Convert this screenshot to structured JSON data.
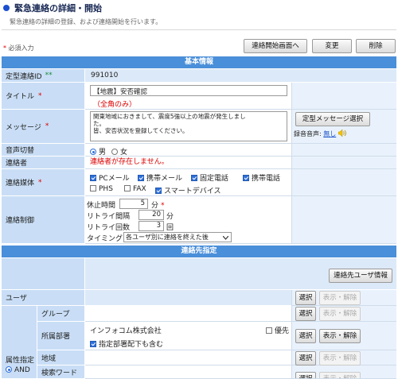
{
  "header": {
    "title": "緊急連絡の詳細・開始",
    "subtitle": "緊急連絡の詳細の登録、および連絡開始を行います。",
    "required_note": "必須入力",
    "required_mark": "*"
  },
  "toolbar": {
    "start_screen": "連絡開始画面へ",
    "edit": "変更",
    "delete": "削除"
  },
  "sections": {
    "basic": "基本情報",
    "contacts": "連絡先指定"
  },
  "form": {
    "fixed_id": {
      "label": "定型連絡ID",
      "mark": "**",
      "value": "991010"
    },
    "title": {
      "label": "タイトル",
      "mark": "*",
      "value": "【地震】安否確認",
      "note": "（全角のみ）"
    },
    "message": {
      "label": "メッセージ",
      "mark": "*",
      "line1": "関東地域におきまして、震度5強以上の地震が発生しまし",
      "line2": "た。",
      "line3": "",
      "line4": "皆、安否状況を登録してください。",
      "select_button": "定型メッセージ選択",
      "voice_label": "録音音声:",
      "voice_value": "無し"
    },
    "voice_switch": {
      "label": "音声切替",
      "male": "男",
      "female": "女"
    },
    "sender": {
      "label": "連絡者",
      "value": "連絡者が存在しません。"
    },
    "media": {
      "label": "連絡媒体",
      "mark": "*",
      "pc_mail": "PCメール",
      "mobile_mail": "携帯メール",
      "landline": "固定電話",
      "mobile_phone": "携帯電話",
      "phs": "PHS",
      "fax": "FAX",
      "smart_device": "スマートデバイス"
    },
    "control": {
      "label": "連絡制御",
      "pause_label": "休止時間",
      "pause_value": "5",
      "pause_unit": "分",
      "pause_mark": "*",
      "retry_interval_label": "リトライ間隔",
      "retry_interval_value": "20",
      "retry_interval_unit": "分",
      "retry_count_label": "リトライ回数",
      "retry_count_value": "3",
      "retry_count_unit": "回",
      "timing_label": "タイミング",
      "timing_value": "各ユーザ別に連絡を終えた後"
    }
  },
  "contacts": {
    "user_info_button": "連絡先ユーザ情報",
    "user_label": "ユーザ",
    "attr_label": "属性指定",
    "and_label": "AND",
    "group_label": "グループ",
    "dept_label": "所属部署",
    "dept_value": "インフォコム株式会社",
    "priority_label": "優先",
    "include_sub": "指定部署配下も含む",
    "region_label": "地域",
    "keyword_label": "検索ワード",
    "select": "選択",
    "show_clear": "表示・解除"
  },
  "colors": {
    "band": "#4a8fd9",
    "label_bg": "#c9def6",
    "required": "#dd0000",
    "link": "#1b53c9"
  },
  "icons": {
    "title_bullet": "blue-dot-icon",
    "speaker": "speaker-icon"
  }
}
